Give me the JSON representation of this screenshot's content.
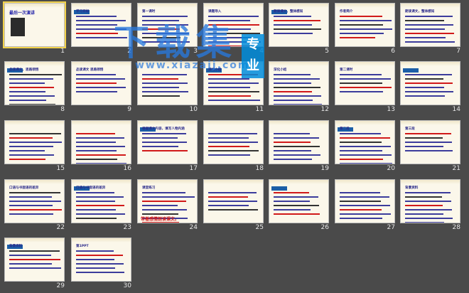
{
  "watermark": {
    "main": "下载集",
    "sub": "www.xiazaij.com",
    "badge": "专业"
  },
  "slides": [
    {
      "n": "1",
      "title": "最后一次演讲"
    },
    {
      "n": "2",
      "title": "学习目标"
    },
    {
      "n": "3",
      "title": "第一课时"
    },
    {
      "n": "4",
      "title": "课题导入"
    },
    {
      "n": "5",
      "title": "朗读课文，整体感知"
    },
    {
      "n": "6",
      "title": "作者简介"
    },
    {
      "n": "7",
      "title": "朗读课文，整体感知"
    },
    {
      "n": "8",
      "title": "品读课文，思路领悟"
    },
    {
      "n": "9",
      "title": "品读课文 思路领悟"
    },
    {
      "n": "10",
      "title": ""
    },
    {
      "n": "11",
      "title": "深化小结"
    },
    {
      "n": "12",
      "title": "深化小结"
    },
    {
      "n": "13",
      "title": "第二课时"
    },
    {
      "n": "14",
      "title": ""
    },
    {
      "n": "15",
      "title": ""
    },
    {
      "n": "16",
      "title": ""
    },
    {
      "n": "17",
      "title": "根据课文内容，填写人物内涵"
    },
    {
      "n": "18",
      "title": ""
    },
    {
      "n": "19",
      "title": ""
    },
    {
      "n": "20",
      "title": "第二段"
    },
    {
      "n": "21",
      "title": "第三段"
    },
    {
      "n": "22",
      "title": "口语与书面语的差异"
    },
    {
      "n": "23",
      "title": "口语与书面语的差异"
    },
    {
      "n": "24",
      "title": "课堂练习"
    },
    {
      "n": "25",
      "title": ""
    },
    {
      "n": "26",
      "title": ""
    },
    {
      "n": "27",
      "title": ""
    },
    {
      "n": "28",
      "title": "背景资料"
    },
    {
      "n": "29",
      "title": "背景资料"
    },
    {
      "n": "30",
      "title": "第1PPT"
    }
  ],
  "slide24_caption": "带着感情朗读课文。"
}
